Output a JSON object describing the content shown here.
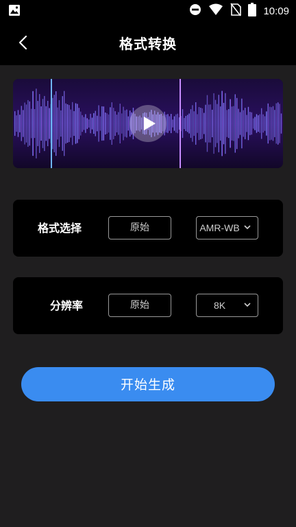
{
  "status_bar": {
    "time": "10:09"
  },
  "header": {
    "title": "格式转换"
  },
  "player": {
    "state": "paused"
  },
  "format_row": {
    "label": "格式选择",
    "source": "原始",
    "selected": "AMR-WB"
  },
  "rate_row": {
    "label": "分辨率",
    "source": "原始",
    "selected": "8K"
  },
  "start_button": {
    "label": "开始生成"
  },
  "colors": {
    "accent": "#3a8cf0",
    "card": "#000000",
    "background": "#1f1e1f",
    "wave_start": "#3db6ff",
    "wave_end": "#c24dff"
  }
}
